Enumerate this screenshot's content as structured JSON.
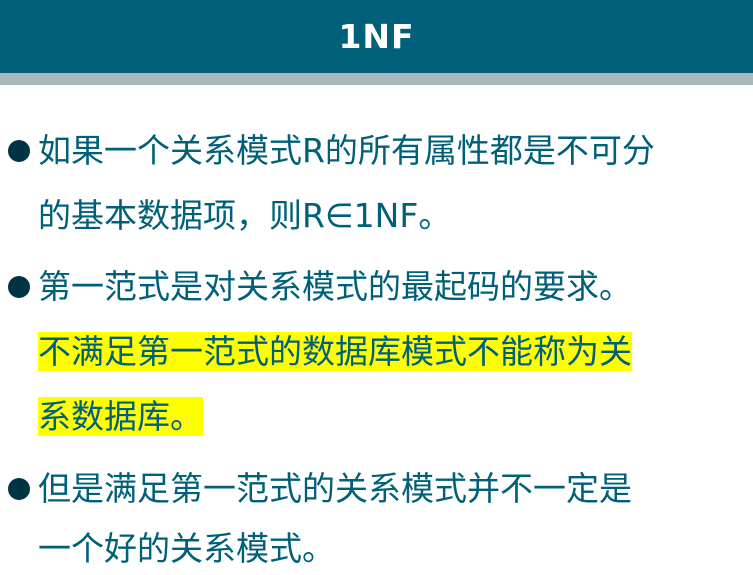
{
  "header": {
    "title": "1NF"
  },
  "colors": {
    "header_bg": "#006079",
    "header_underline": "#a9b8c0",
    "body_text": "#006079",
    "bullet": "#003344",
    "highlight": "#ffff00"
  },
  "bullets": [
    {
      "lines": [
        "如果一个关系模式R的所有属性都是不可分",
        "的基本数据项，则R∈1NF。"
      ]
    },
    {
      "lines": [
        "第一范式是对关系模式的最起码的要求。"
      ],
      "highlighted_lines": [
        "不满足第一范式的数据库模式不能称为关",
        "系数据库。"
      ]
    },
    {
      "lines": [
        "但是满足第一范式的关系模式并不一定是",
        "一个好的关系模式。"
      ]
    }
  ]
}
